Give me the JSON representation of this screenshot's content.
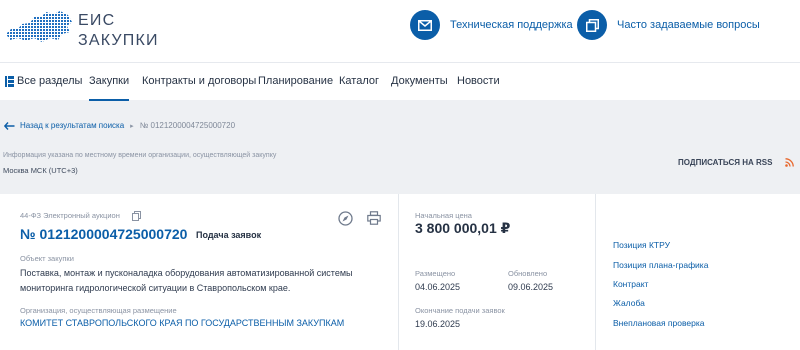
{
  "header": {
    "logo_line1": "ЕИС",
    "logo_line2": "ЗАКУПКИ",
    "support_label": "Техническая поддержка",
    "faq_label": "Часто задаваемые вопросы",
    "icons": [
      "mail-icon",
      "windows-icon"
    ],
    "accent_color": "#0b5ea8"
  },
  "nav": {
    "items": [
      {
        "label": "Все разделы"
      },
      {
        "label": "Закупки"
      },
      {
        "label": "Контракты и договоры"
      },
      {
        "label": "Планирование"
      },
      {
        "label": "Каталог"
      },
      {
        "label": "Документы"
      },
      {
        "label": "Новости"
      }
    ],
    "active": "Закупки"
  },
  "breadcrumb": {
    "back_label": "Назад к результатам поиска",
    "current": "№ 0121200004725000720"
  },
  "timezone": {
    "note": "Информация указана по местному времени организации, осуществляющей закупку",
    "value": "Москва МСК (UTC+3)"
  },
  "rss_label": "ПОДПИСАТЬСЯ НА RSS",
  "purchase": {
    "law_type": "44-ФЗ Электронный аукцион",
    "number": "№ 0121200004725000720",
    "stage": "Подача заявок",
    "subject_label": "Объект закупки",
    "subject": "Поставка, монтаж и пусконаладка оборудования автоматизированной системы мониторинга гидрологической ситуации в Ставропольском крае.",
    "org_label": "Организация, осуществляющая размещение",
    "org": "КОМИТЕТ СТАВРОПОЛЬСКОГО КРАЯ ПО ГОСУДАРСТВЕННЫМ ЗАКУПКАМ",
    "price_label": "Начальная цена",
    "price": "3 800 000,01 ₽",
    "posted_label": "Размещено",
    "posted": "04.06.2025",
    "updated_label": "Обновлено",
    "updated": "09.06.2025",
    "deadline_label": "Окончание подачи заявок",
    "deadline": "19.06.2025"
  },
  "side_links": [
    {
      "label": "Позиция КТРУ"
    },
    {
      "label": "Позиция плана-графика"
    },
    {
      "label": "Контракт"
    },
    {
      "label": "Жалоба"
    },
    {
      "label": "Внеплановая проверка"
    }
  ]
}
